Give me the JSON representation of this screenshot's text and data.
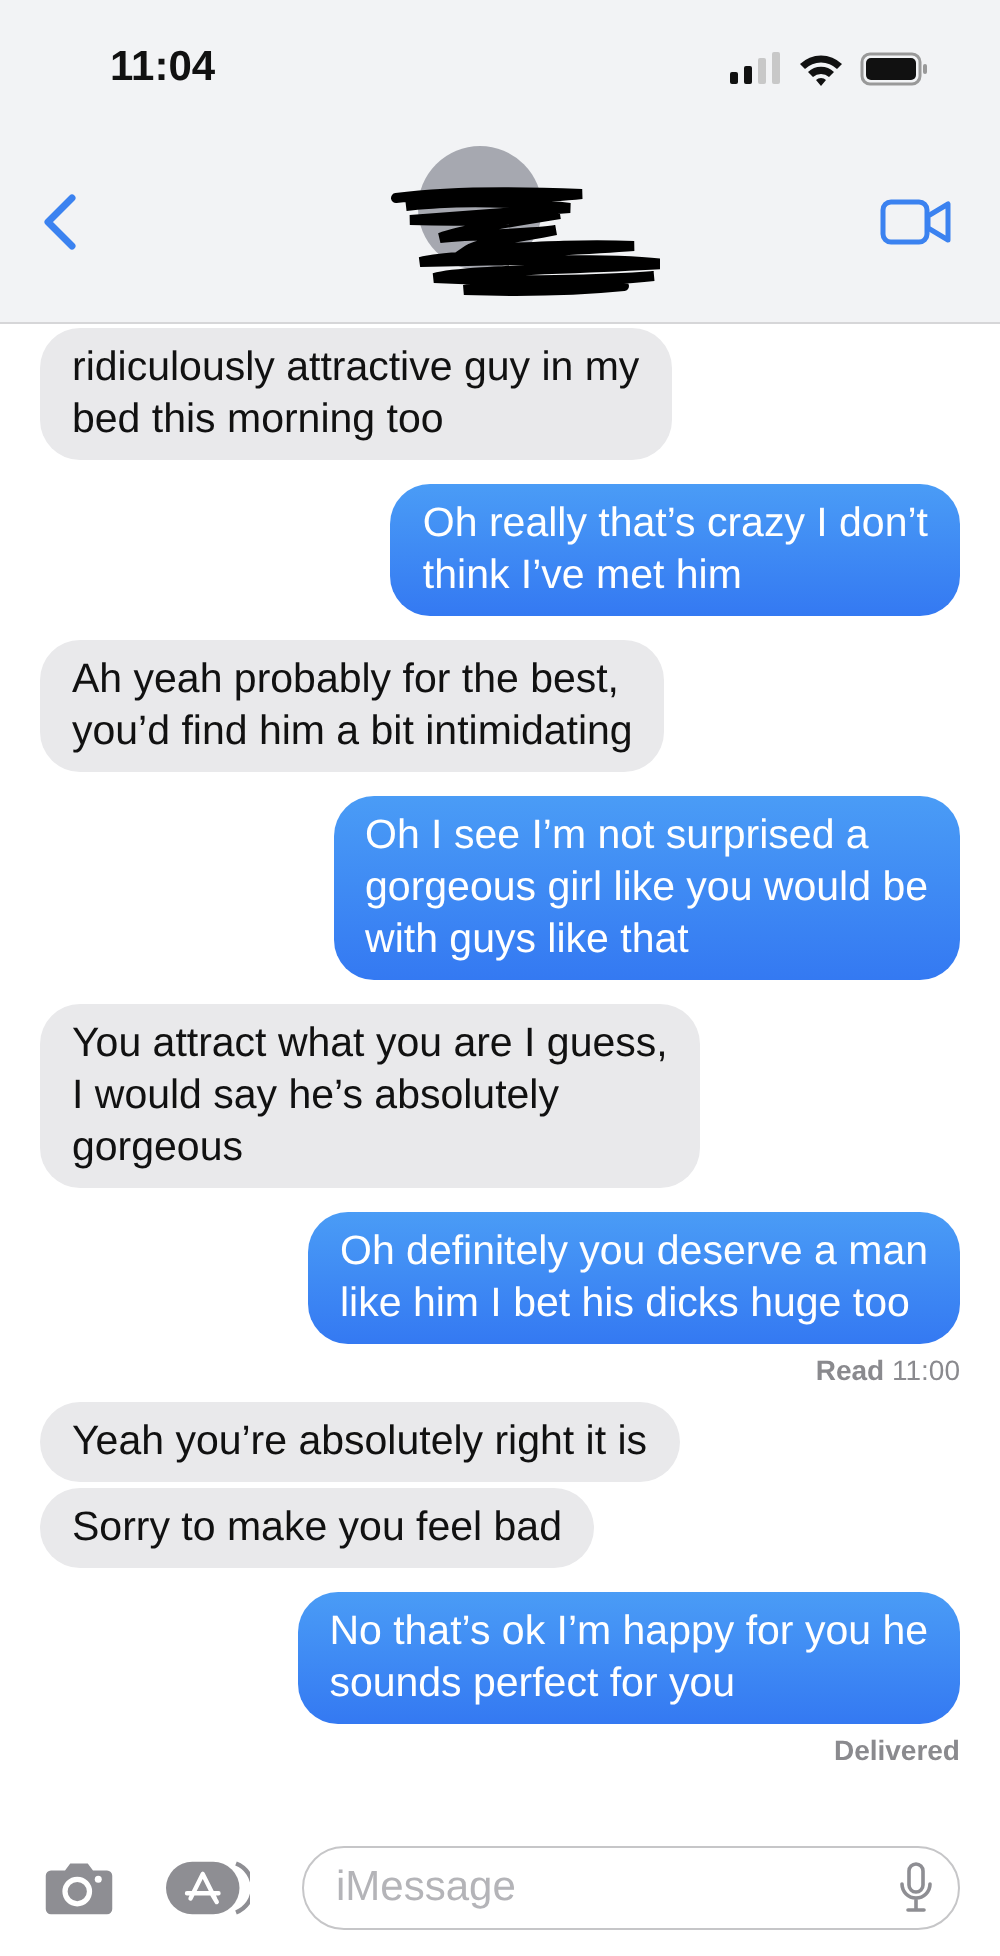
{
  "status_bar": {
    "time": "11:04"
  },
  "messages": [
    {
      "kind": "received",
      "lines": [
        "ridiculously attractive guy in my",
        "bed this morning too"
      ]
    },
    {
      "kind": "sent",
      "lines": [
        "Oh really that’s crazy I don’t",
        "think I’ve met him"
      ]
    },
    {
      "kind": "received",
      "lines": [
        "Ah yeah probably for the best,",
        "you’d find him a bit intimidating"
      ]
    },
    {
      "kind": "sent",
      "lines": [
        "Oh I see I’m not surprised a",
        "gorgeous girl like you would be",
        "with guys like that"
      ]
    },
    {
      "kind": "received",
      "lines": [
        "You attract what you are I guess,",
        "I would say he’s absolutely",
        "gorgeous"
      ]
    },
    {
      "kind": "sent",
      "lines": [
        "Oh definitely you deserve a man",
        "like him I bet his dicks huge too"
      ]
    },
    {
      "kind": "status",
      "text": "**Read** 11:00"
    },
    {
      "kind": "received",
      "lines": [
        "Yeah you’re absolutely right it is"
      ]
    },
    {
      "kind": "received",
      "lines": [
        "Sorry to make you feel bad"
      ]
    },
    {
      "kind": "sent",
      "lines": [
        "No that’s ok I’m happy for you he",
        "sounds perfect for you"
      ]
    },
    {
      "kind": "status",
      "text": "**Delivered**"
    }
  ],
  "compose": {
    "placeholder": "iMessage"
  }
}
